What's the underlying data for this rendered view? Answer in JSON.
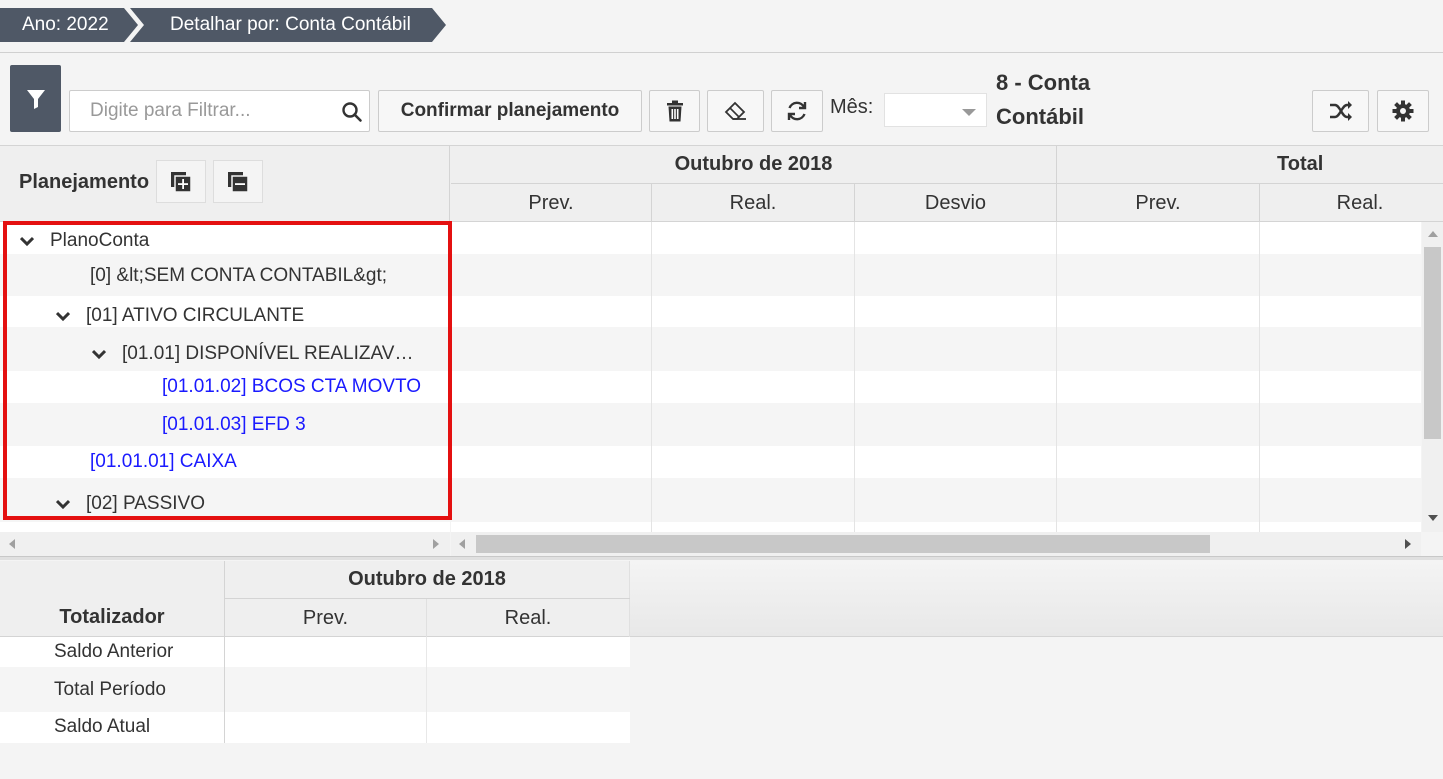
{
  "breadcrumb": {
    "year": "Ano: 2022",
    "detail": "Detalhar por: Conta Contábil"
  },
  "toolbar": {
    "filter_icon": "filter-icon",
    "search_placeholder": "Digite para Filtrar...",
    "search_value": "",
    "confirm_label": "Confirmar planejamento",
    "delete_icon": "trash-icon",
    "clear_icon": "eraser-icon",
    "refresh_icon": "refresh-icon",
    "month_label": "Mês:",
    "month_value": "",
    "view_title": "8 - Conta Contábil",
    "shuffle_icon": "shuffle-icon",
    "settings_icon": "gear-icon"
  },
  "grid": {
    "left_header": "Planejamento",
    "period_header": "Outubro de 2018",
    "total_header": "Total",
    "columns": [
      "Prev.",
      "Real.",
      "Desvio",
      "Prev.",
      "Real."
    ],
    "tree": [
      {
        "label": "PlanoConta",
        "level": 0,
        "expanded": true,
        "link": false
      },
      {
        "label": "[0] &lt;SEM CONTA CONTABIL&gt;",
        "level": 1,
        "expanded": null,
        "link": false
      },
      {
        "label": "[01] ATIVO CIRCULANTE",
        "level": 1,
        "expanded": true,
        "link": false
      },
      {
        "label": "[01.01] DISPONÍVEL REALIZAV…",
        "level": 2,
        "expanded": true,
        "link": false
      },
      {
        "label": "[01.01.02] BCOS CTA MOVTO",
        "level": 3,
        "expanded": null,
        "link": true
      },
      {
        "label": "[01.01.03] EFD 3",
        "level": 3,
        "expanded": null,
        "link": true
      },
      {
        "label": "[01.01.01] CAIXA",
        "level": 1,
        "expanded": null,
        "link": true
      },
      {
        "label": "[02] PASSIVO",
        "level": 1,
        "expanded": true,
        "link": false
      }
    ]
  },
  "totalizador": {
    "header": "Totalizador",
    "period_header": "Outubro de 2018",
    "columns": [
      "Prev.",
      "Real."
    ],
    "rows": [
      "Saldo Anterior",
      "Total Período",
      "Saldo Atual"
    ]
  },
  "colors": {
    "dark": "#4f5866",
    "link": "#1a1aff",
    "highlight": "#e41010"
  }
}
